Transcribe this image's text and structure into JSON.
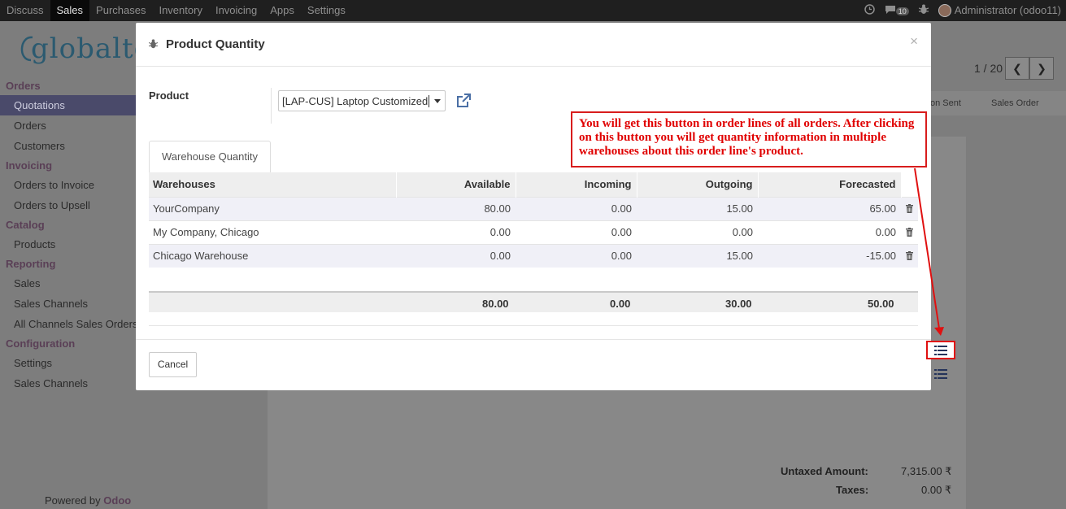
{
  "navbar": {
    "menu": [
      "Discuss",
      "Sales",
      "Purchases",
      "Inventory",
      "Invoicing",
      "Apps",
      "Settings"
    ],
    "active_menu": "Sales",
    "notification_count": "10",
    "user": "Administrator (odoo11)"
  },
  "background": {
    "logo_text": "globaltec",
    "sidebar": [
      {
        "header": "Orders",
        "items": [
          "Quotations",
          "Orders",
          "Customers"
        ]
      },
      {
        "header": "Invoicing",
        "items": [
          "Orders to Invoice",
          "Orders to Upsell"
        ]
      },
      {
        "header": "Catalog",
        "items": [
          "Products"
        ]
      },
      {
        "header": "Reporting",
        "items": [
          "Sales",
          "Sales Channels",
          "All Channels Sales Orders"
        ]
      },
      {
        "header": "Configuration",
        "items": [
          "Settings",
          "Sales Channels"
        ]
      }
    ],
    "active_item": "Quotations",
    "powered_by": "Powered by",
    "powered_brand": "Odoo",
    "pager": "1 / 20",
    "pager_prev": "❮",
    "pager_next": "❯",
    "status_steps": [
      "on Sent",
      "Sales Order"
    ],
    "totals": {
      "untaxed_label": "Untaxed Amount:",
      "untaxed_value": "7,315.00 ₹",
      "taxes_label": "Taxes:",
      "taxes_value": "0.00 ₹"
    }
  },
  "modal": {
    "title": "Product Quantity",
    "close": "×",
    "product_label": "Product",
    "product_value": "[LAP-CUS] Laptop Customized",
    "tab_label": "Warehouse Quantity",
    "columns": [
      "Warehouses",
      "Available",
      "Incoming",
      "Outgoing",
      "Forecasted"
    ],
    "rows": [
      {
        "warehouse": "YourCompany",
        "available": "80.00",
        "incoming": "0.00",
        "outgoing": "15.00",
        "forecasted": "65.00"
      },
      {
        "warehouse": "My Company, Chicago",
        "available": "0.00",
        "incoming": "0.00",
        "outgoing": "0.00",
        "forecasted": "0.00"
      },
      {
        "warehouse": "Chicago Warehouse",
        "available": "0.00",
        "incoming": "0.00",
        "outgoing": "15.00",
        "forecasted": "-15.00"
      }
    ],
    "totals": {
      "available": "80.00",
      "incoming": "0.00",
      "outgoing": "30.00",
      "forecasted": "50.00"
    },
    "cancel_label": "Cancel"
  },
  "annotation": {
    "text": "You will get this button in order lines of all orders. After clicking on this button you will get quantity information in multiple warehouses about this order line's product.",
    "color": "#e00000"
  },
  "colors": {
    "navbar_bg": "#1f1f1f",
    "sidebar_header": "#5a3f56",
    "annotation_red": "#d81d1d"
  }
}
